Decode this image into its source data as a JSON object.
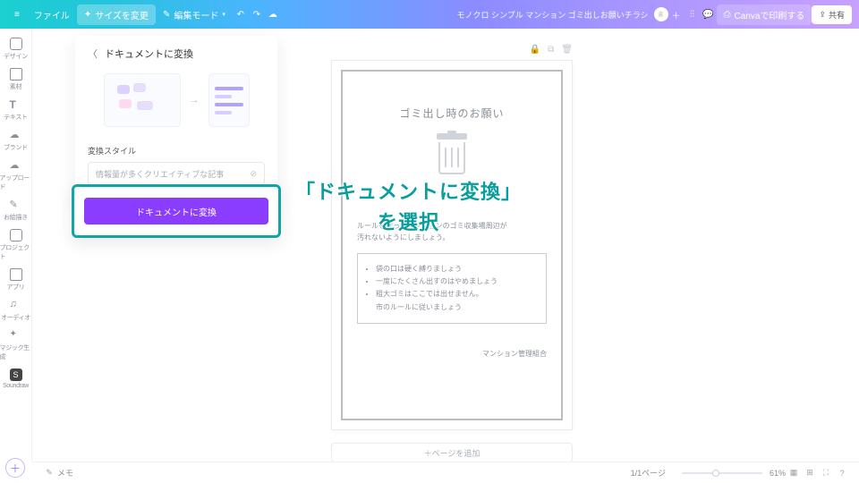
{
  "header": {
    "file": "ファイル",
    "resize": "サイズを変更",
    "editmode": "編集モード",
    "docname": "モノクロ シンプル マンション ゴミ出しお願いチラシ",
    "print": "Canvaで印刷する",
    "share": "共有"
  },
  "sidebar": {
    "items": [
      {
        "label": "デザイン"
      },
      {
        "label": "素材"
      },
      {
        "label": "テキスト"
      },
      {
        "label": "ブランド"
      },
      {
        "label": "アップロード"
      },
      {
        "label": "お絵描き"
      },
      {
        "label": "プロジェクト"
      },
      {
        "label": "アプリ"
      },
      {
        "label": "オーディオ"
      },
      {
        "label": "マジック生成"
      },
      {
        "label": "Soundraw"
      }
    ]
  },
  "panel": {
    "title": "ドキュメントに変換",
    "style_label": "変換スタイル",
    "style_value": "情報量が多くクリエイティブな記事",
    "convert_btn": "ドキュメントに変換"
  },
  "canvas": {
    "title": "ゴミ出し時のお願い",
    "desc1": "ルールを守ってマンションのゴミ収集場周辺が",
    "desc2": "汚れないようにしましょう。",
    "rules": [
      "袋の口は硬く縛りましょう",
      "一度にたくさん出すのはやめましょう",
      "粗大ゴミはここでは出せません。",
      "市のルールに従いましょう"
    ],
    "footer": "マンション管理組合",
    "addpage": "＋ページを追加"
  },
  "callout": {
    "line1": "「ドキュメントに変換」",
    "line2": "を選択"
  },
  "footer": {
    "memo": "メモ",
    "page": "1/1ページ",
    "zoom": "61%"
  }
}
